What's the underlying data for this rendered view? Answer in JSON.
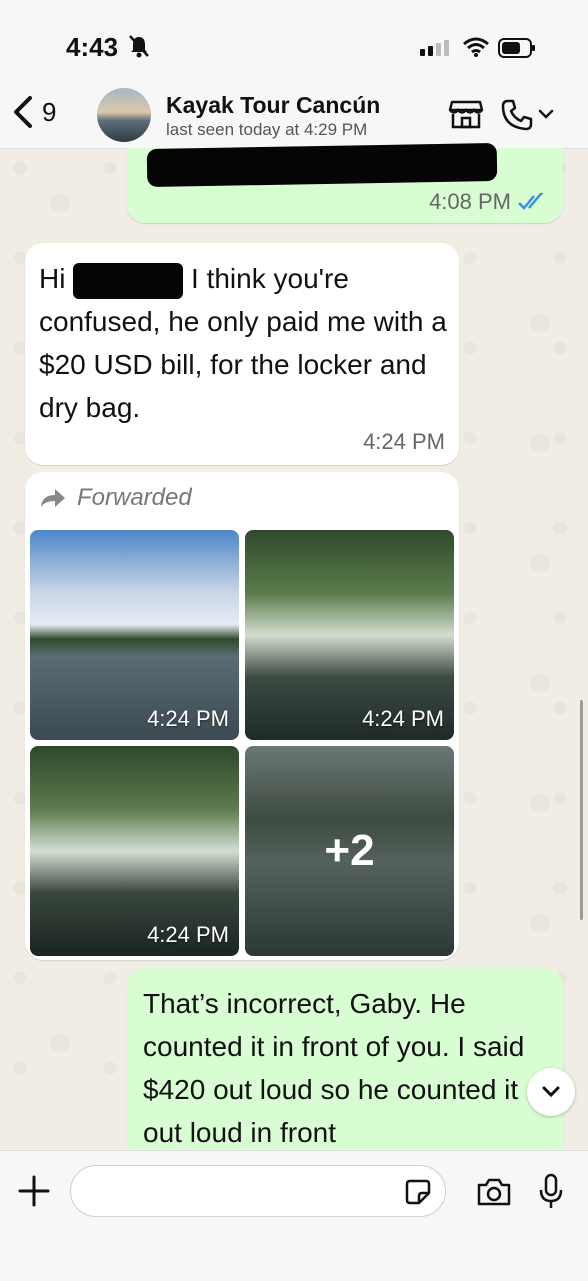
{
  "status_bar": {
    "time": "4:43"
  },
  "header": {
    "back_count": "9",
    "contact_name": "Kayak Tour Cancún",
    "last_seen": "last seen today at 4:29 PM"
  },
  "messages": {
    "m1": {
      "time": "4:08 PM"
    },
    "m2": {
      "text_before": "Hi",
      "text_after": "I think you're confused, he only paid me with a $20 USD bill, for the locker and dry bag.",
      "time": "4:24 PM"
    },
    "m3": {
      "forwarded_label": "Forwarded",
      "photos": [
        {
          "time": "4:24 PM"
        },
        {
          "time": "4:24 PM"
        },
        {
          "time": "4:24 PM"
        }
      ],
      "more_count": "+2"
    },
    "m4": {
      "text": "That’s incorrect, Gaby. He counted it in front of you. I said $420 out loud so he counted it out loud in front"
    }
  },
  "composer": {
    "value": ""
  },
  "colors": {
    "outgoing": "#d9fdd3",
    "incoming": "#ffffff",
    "read_ticks": "#3b8ee8"
  }
}
